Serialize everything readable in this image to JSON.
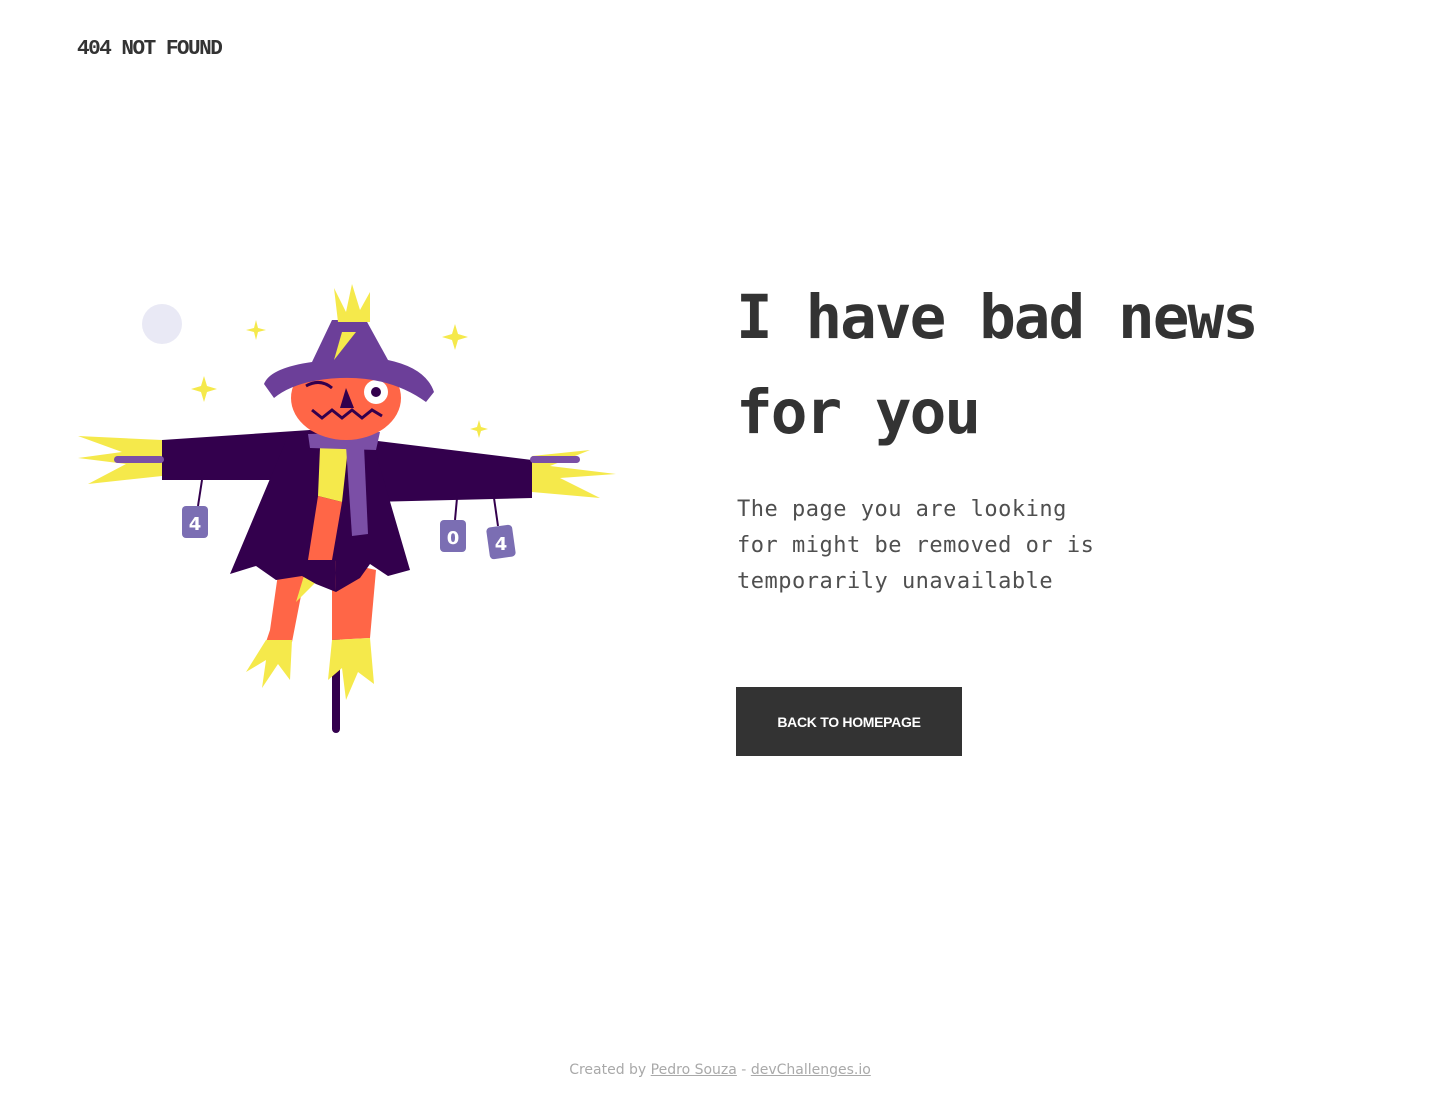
{
  "header": {
    "brand": "404 NOT FOUND"
  },
  "hero": {
    "headline": "I have bad news for you",
    "subtext": "The page you are looking for might be removed or is temporarily unavailable",
    "cta_label": "BACK TO HOMEPAGE"
  },
  "illustration": {
    "subject": "scarecrow-icon",
    "can_labels": [
      "4",
      "0",
      "4"
    ],
    "colors": {
      "hat": "#6c3f99",
      "coat": "#33004d",
      "face": "#ff6647",
      "straw": "#f5e94b",
      "scarf": "#7b4fa6",
      "moon": "#e9e9f5"
    }
  },
  "footer": {
    "prefix": "Created by",
    "author": "Pedro Souza",
    "separator": "-",
    "site": "devChallenges.io"
  },
  "colors": {
    "text": "#333333",
    "button_bg": "#333333",
    "button_text": "#ffffff",
    "footer_text": "#a9a9a9",
    "background": "#ffffff"
  }
}
